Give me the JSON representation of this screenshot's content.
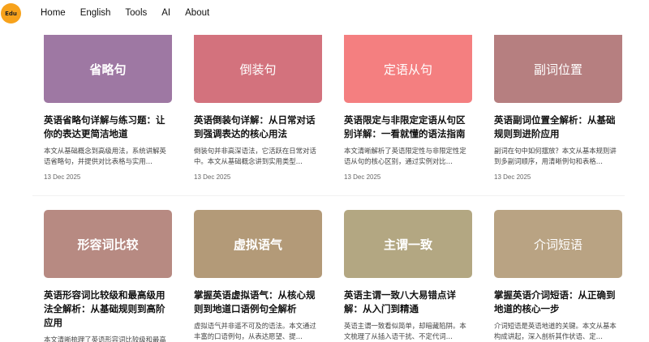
{
  "brand": {
    "logo_text": "Edu",
    "logo_color": "#f7a21b"
  },
  "nav": {
    "items": [
      "Home",
      "English",
      "Tools",
      "AI",
      "About"
    ]
  },
  "cards": [
    {
      "thumb_text": "省略句",
      "thumb_color": "#9e78a3",
      "bold": true,
      "title": "英语省略句详解与练习题：让你的表达更简洁地道",
      "desc": "本文从基础概念到高级用法，系统讲解英语省略句，并提供对比表格与实用…",
      "date": "13 Dec 2025"
    },
    {
      "thumb_text": "倒装句",
      "thumb_color": "#d3727d",
      "bold": false,
      "title": "英语倒装句详解：从日常对话到强调表达的核心用法",
      "desc": "倒装句并非高深语法，它活跃在日常对话中。本文从基础概念讲到实用类型…",
      "date": "13 Dec 2025"
    },
    {
      "thumb_text": "定语从句",
      "thumb_color": "#f47f80",
      "bold": false,
      "title": "英语限定与非限定定语从句区别详解：一看就懂的语法指南",
      "desc": "本文清晰解析了英语限定性与非限定性定语从句的核心区别，通过实例对比…",
      "date": "13 Dec 2025"
    },
    {
      "thumb_text": "副词位置",
      "thumb_color": "#b67f80",
      "bold": false,
      "title": "英语副词位置全解析：从基础规则到进阶应用",
      "desc": "副词在句中如何摆放？本文从基本规则讲到多副词顺序，用清晰例句和表格…",
      "date": "13 Dec 2025"
    },
    {
      "thumb_text": "形容词比较",
      "thumb_color": "#b78a82",
      "bold": true,
      "title": "英语形容词比较级和最高级用法全解析：从基础规则到高阶应用",
      "desc": "本文清晰梳理了英语形容词比较级和最高级的构成与用法…",
      "date": ""
    },
    {
      "thumb_text": "虚拟语气",
      "thumb_color": "#b39a78",
      "bold": true,
      "title": "掌握英语虚拟语气：从核心规则到地道口语例句全解析",
      "desc": "虚拟语气并非遥不可及的语法。本文通过丰富的口语例句，从表达愿望、提…",
      "date": ""
    },
    {
      "thumb_text": "主谓一致",
      "thumb_color": "#b3a782",
      "bold": true,
      "title": "英语主谓一致八大易错点详解：从入门到精通",
      "desc": "英语主谓一致看似简单，却暗藏陷阱。本文梳理了从插入语干扰、不定代词…",
      "date": ""
    },
    {
      "thumb_text": "介词短语",
      "thumb_color": "#b9a383",
      "bold": false,
      "title": "掌握英语介词短语：从正确到地道的核心一步",
      "desc": "介词短语是英语地道的关键。本文从基本构成讲起，深入剖析其作状语、定…",
      "date": ""
    }
  ]
}
